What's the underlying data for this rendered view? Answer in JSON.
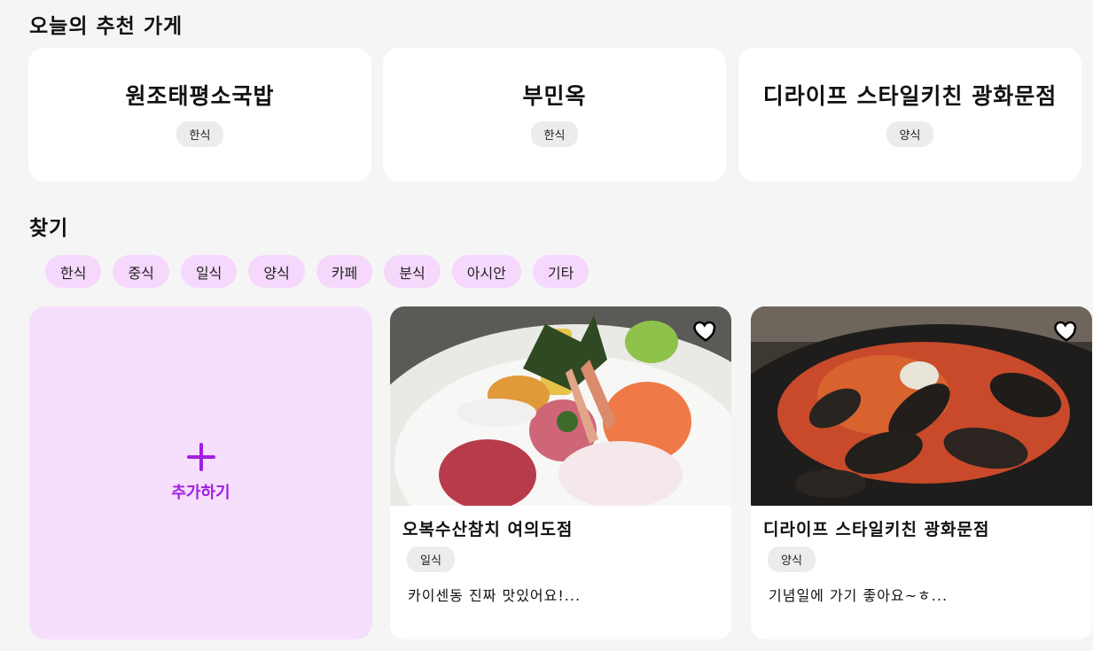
{
  "today": {
    "title": "오늘의 추천 가게",
    "cards": [
      {
        "name": "원조태평소국밥",
        "category": "한식"
      },
      {
        "name": "부민옥",
        "category": "한식"
      },
      {
        "name": "디라이프 스타일키친 광화문점",
        "category": "양식"
      }
    ]
  },
  "find": {
    "title": "찾기",
    "chips": [
      "한식",
      "중식",
      "일식",
      "양식",
      "카페",
      "분식",
      "아시안",
      "기타"
    ]
  },
  "add_card": {
    "label": "추가하기"
  },
  "stores": [
    {
      "name": "오복수산참치 여의도점",
      "category": "일식",
      "review": "카이센동 진짜 맛있어요!...",
      "photo": "sashimi rice bowl"
    },
    {
      "name": "디라이프 스타일키친 광화문점",
      "category": "양식",
      "review": "기념일에 가기 좋아요~ㅎ...",
      "photo": "mussel pasta"
    }
  ],
  "icons": {
    "favorite": "heart-outline-icon",
    "add": "plus-icon"
  },
  "colors": {
    "accent": "#a020e0",
    "chip_bg": "#f6d8fc",
    "add_bg": "#f6defd"
  }
}
